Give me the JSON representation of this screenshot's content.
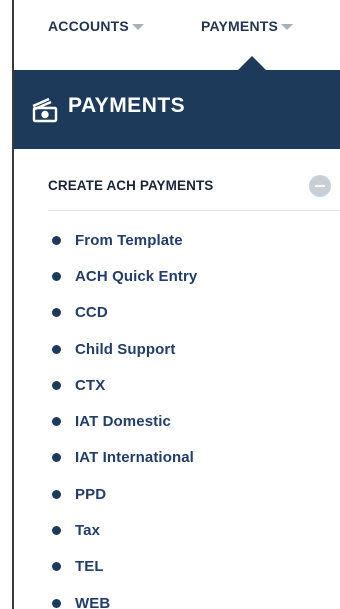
{
  "top_nav": {
    "items": [
      {
        "label": "ACCOUNTS"
      },
      {
        "label": "PAYMENTS"
      }
    ]
  },
  "header": {
    "title": "PAYMENTS",
    "icon": "payments-cash-icon",
    "background_color": "#1d3a5a"
  },
  "section": {
    "title": "CREATE ACH PAYMENTS",
    "collapse_icon": "minus-circle-icon",
    "items": [
      {
        "label": "From Template"
      },
      {
        "label": "ACH Quick Entry"
      },
      {
        "label": "CCD"
      },
      {
        "label": "Child Support"
      },
      {
        "label": "CTX"
      },
      {
        "label": "IAT Domestic"
      },
      {
        "label": "IAT International"
      },
      {
        "label": "PPD"
      },
      {
        "label": "Tax"
      },
      {
        "label": "TEL"
      },
      {
        "label": "WEB"
      }
    ]
  },
  "colors": {
    "accent_dark": "#1d3a5a",
    "text_dark": "#243550"
  }
}
